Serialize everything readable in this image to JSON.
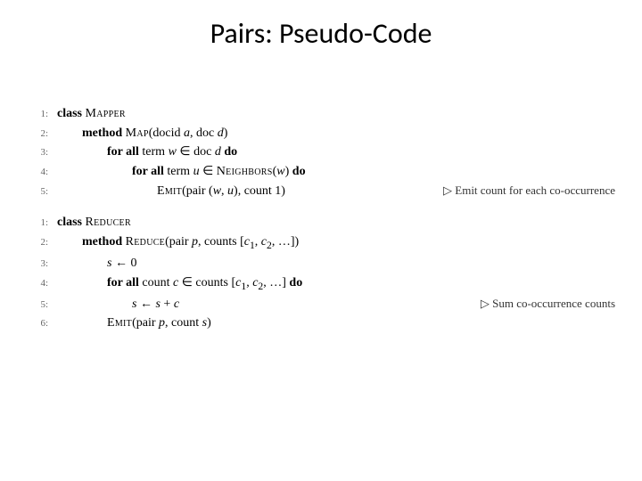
{
  "title": "Pairs: Pseudo-Code",
  "mapper": {
    "ln1": "1:",
    "ln2": "2:",
    "ln3": "3:",
    "ln4": "4:",
    "ln5": "5:",
    "kw_class": "class ",
    "name": "Mapper",
    "kw_method": "method ",
    "method_name": "Map",
    "method_args_open": "(docid ",
    "arg_a": "a",
    "method_args_mid": ", doc ",
    "arg_d": "d",
    "method_args_close": ")",
    "kw_for_all": "for all ",
    "term_w_pre": "term ",
    "var_w": "w",
    "in_doc": " ∈ doc ",
    "var_d": "d",
    "do": " do",
    "term_u_pre": "term ",
    "var_u": "u",
    "in_neigh": " ∈ ",
    "neighbors": "Neighbors",
    "neigh_open": "(",
    "neigh_w": "w",
    "neigh_close": ") ",
    "do2": "do",
    "emit": "Emit",
    "emit_args_open": "(pair (",
    "emit_w": "w",
    "emit_comma": ", ",
    "emit_u": "u",
    "emit_args_close": "), count 1)",
    "comment": "▷ Emit count for each co-occurrence"
  },
  "reducer": {
    "ln1": "1:",
    "ln2": "2:",
    "ln3": "3:",
    "ln4": "4:",
    "ln5": "5:",
    "ln6": "6:",
    "kw_class": "class ",
    "name": "Reducer",
    "kw_method": "method ",
    "method_name": "Reduce",
    "method_args_open": "(pair ",
    "arg_p": "p",
    "method_args_mid": ", counts [",
    "arg_c1": "c",
    "sub1": "1",
    "arg_c2": "c",
    "sub2": "2",
    "method_args_close": ", …])",
    "s_init_l": "s",
    "s_init_r": " ← 0",
    "kw_for_all": "for all ",
    "count_pre": "count ",
    "var_c": "c",
    "in_counts": " ∈ counts [",
    "c1b": "c",
    "sub1b": "1",
    "c2b": "c",
    "sub2b": "2",
    "counts_close": ", …] ",
    "do": "do",
    "sum_l": "s",
    "sum_mid": " ← ",
    "sum_s": "s",
    "sum_plus": " + ",
    "sum_c": "c",
    "comment": "▷ Sum co-occurrence counts",
    "emit": "Emit",
    "emit_args_open": "(pair ",
    "emit_p": "p",
    "emit_args_mid": ", count ",
    "emit_s": "s",
    "emit_args_close": ")"
  }
}
